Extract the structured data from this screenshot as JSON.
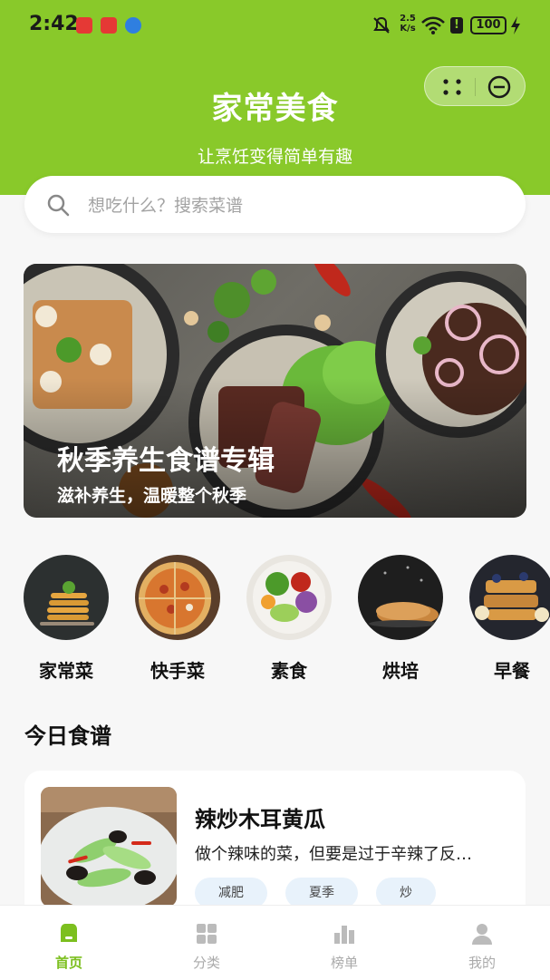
{
  "status_bar": {
    "time": "2:42",
    "net_speed_value": "2.5",
    "net_speed_unit": "K/s",
    "battery": "100"
  },
  "header": {
    "title": "家常美食",
    "subtitle": "让烹饪变得简单有趣"
  },
  "search": {
    "placeholder": "想吃什么？搜索菜谱"
  },
  "banner": {
    "title": "秋季养生食谱专辑",
    "subtitle": "滋补养生，温暖整个秋季"
  },
  "categories": [
    {
      "label": "家常菜"
    },
    {
      "label": "快手菜"
    },
    {
      "label": "素食"
    },
    {
      "label": "烘培"
    },
    {
      "label": "早餐"
    }
  ],
  "today": {
    "section_title": "今日食谱",
    "recipe": {
      "name": "辣炒木耳黄瓜",
      "description": "做个辣味的菜，但要是过于辛辣了反…",
      "tags": [
        "减肥",
        "夏季",
        "炒"
      ]
    }
  },
  "tabbar": [
    {
      "label": "首页",
      "icon": "home-icon",
      "active": true
    },
    {
      "label": "分类",
      "icon": "grid-icon",
      "active": false
    },
    {
      "label": "榜单",
      "icon": "ranking-icon",
      "active": false
    },
    {
      "label": "我的",
      "icon": "user-icon",
      "active": false
    }
  ],
  "colors": {
    "brand": "#89c92a",
    "active_tab": "#7cbf1f"
  }
}
